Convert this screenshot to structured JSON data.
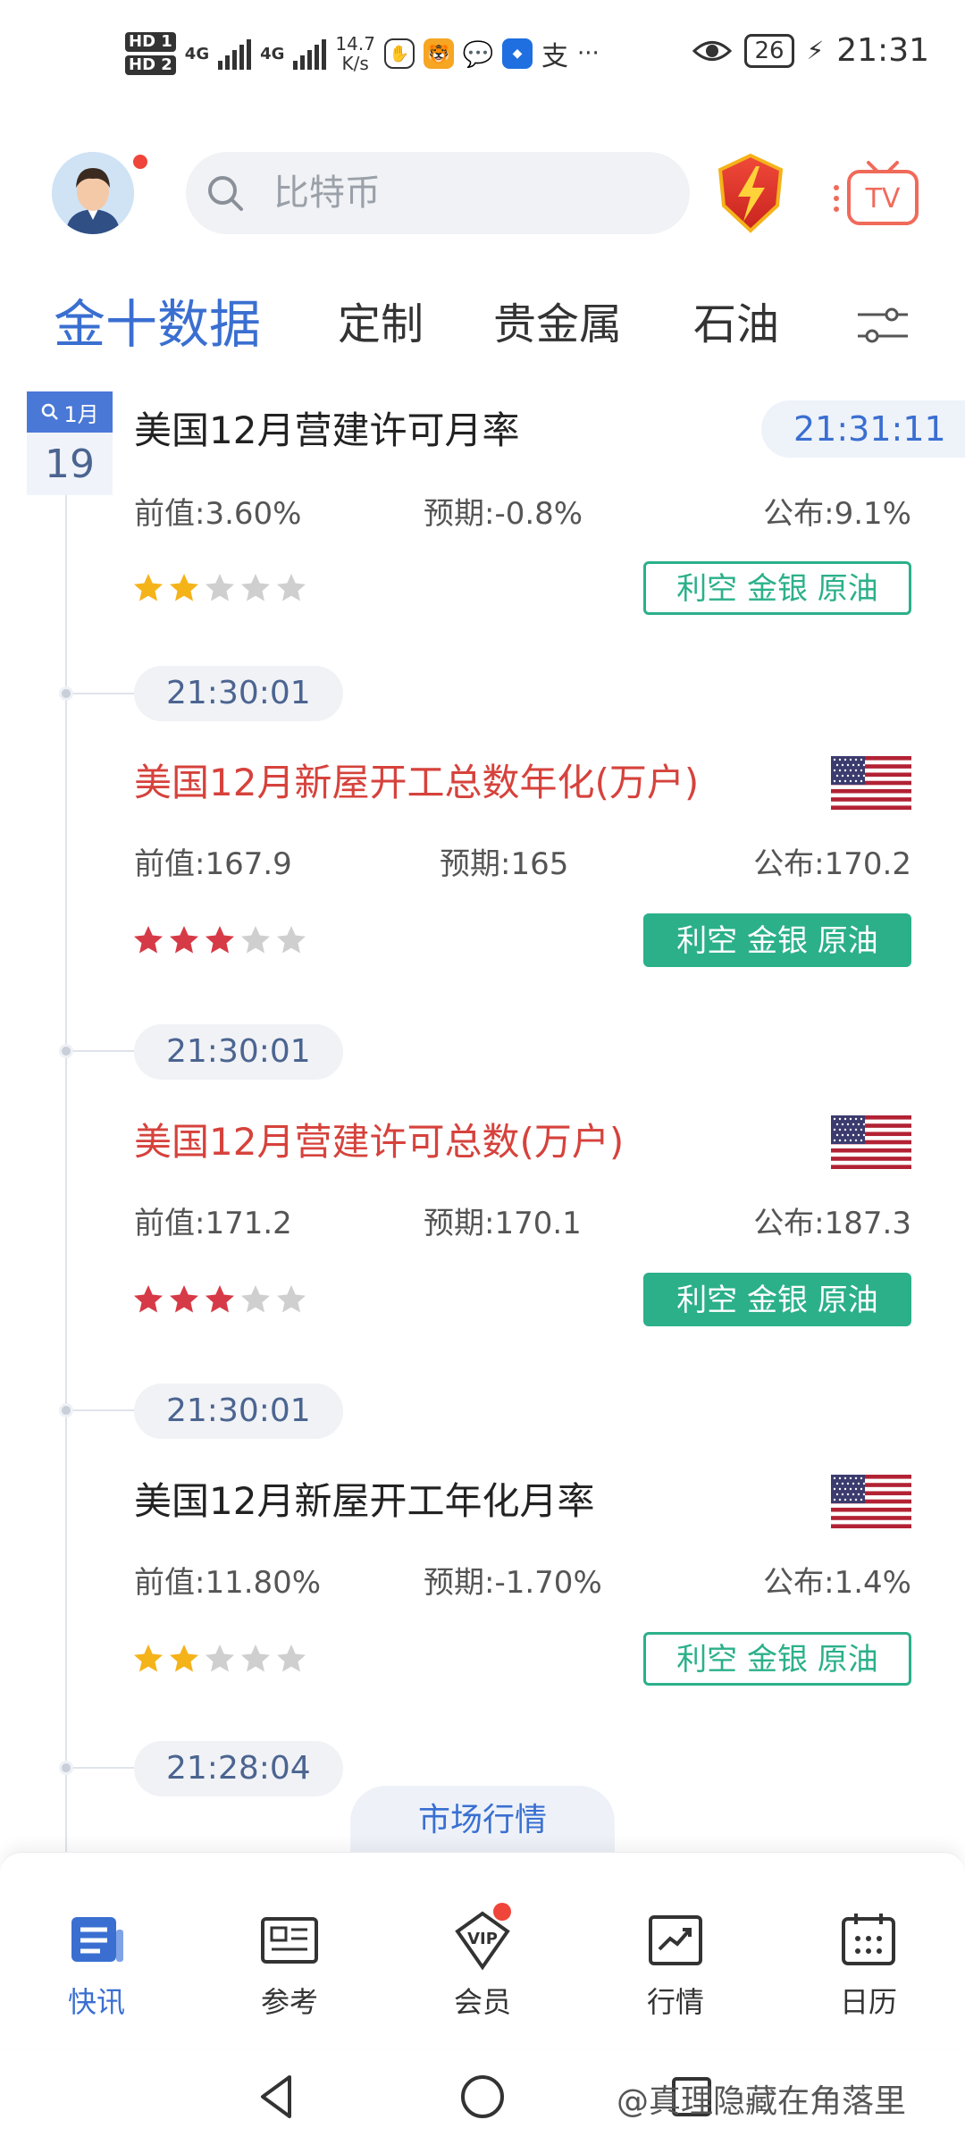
{
  "status_bar": {
    "hd1": "HD 1",
    "hd2": "HD 2",
    "net1": "4G",
    "net2": "4G",
    "speed_value": "14.7",
    "speed_unit": "K/s",
    "battery": "26",
    "time": "21:31",
    "more": "···",
    "app_alipay": "支"
  },
  "header": {
    "search_placeholder": "比特币"
  },
  "tabs": [
    {
      "label": "金十数据",
      "active": true
    },
    {
      "label": "定制"
    },
    {
      "label": "贵金属"
    },
    {
      "label": "石油"
    }
  ],
  "date_badge": {
    "month": "1月",
    "day": "19"
  },
  "items": [
    {
      "title": "美国12月营建许可月率",
      "time": "21:31:11",
      "prev_label": "前值:",
      "prev": "3.60%",
      "forecast_label": "预期:",
      "forecast": "-0.8%",
      "actual_label": "公布:",
      "actual": "9.1%",
      "stars": 2,
      "tag": "利空 金银 原油"
    },
    {
      "time": "21:30:01",
      "title": "美国12月新屋开工总数年化(万户)",
      "prev_label": "前值:",
      "prev": "167.9",
      "forecast_label": "预期:",
      "forecast": "165",
      "actual_label": "公布:",
      "actual": "170.2",
      "stars": 3,
      "tag": "利空 金银 原油"
    },
    {
      "time": "21:30:01",
      "title": "美国12月营建许可总数(万户)",
      "prev_label": "前值:",
      "prev": "171.2",
      "forecast_label": "预期:",
      "forecast": "170.1",
      "actual_label": "公布:",
      "actual": "187.3",
      "stars": 3,
      "tag": "利空 金银 原油"
    },
    {
      "time": "21:30:01",
      "title": "美国12月新屋开工年化月率",
      "prev_label": "前值:",
      "prev": "11.80%",
      "forecast_label": "预期:",
      "forecast": "-1.70%",
      "actual_label": "公布:",
      "actual": "1.4%",
      "stars": 2,
      "tag": "利空 金银 原油"
    },
    {
      "time": "21:28:04"
    }
  ],
  "market_tab": "市场行情",
  "bottom_nav": [
    {
      "label": "快讯",
      "icon": "news-icon",
      "active": true
    },
    {
      "label": "参考",
      "icon": "reference-icon"
    },
    {
      "label": "会员",
      "icon": "vip-icon"
    },
    {
      "label": "行情",
      "icon": "market-icon"
    },
    {
      "label": "日历",
      "icon": "calendar-icon"
    }
  ],
  "watermark": "@真理隐藏在角落里",
  "colors": {
    "accent": "#3a6fd1",
    "red_title": "#d6423c",
    "green_tag": "#2bb08a",
    "star_gold": "#f5b31a",
    "star_red": "#d63a46",
    "star_empty": "#cfcfcf"
  }
}
